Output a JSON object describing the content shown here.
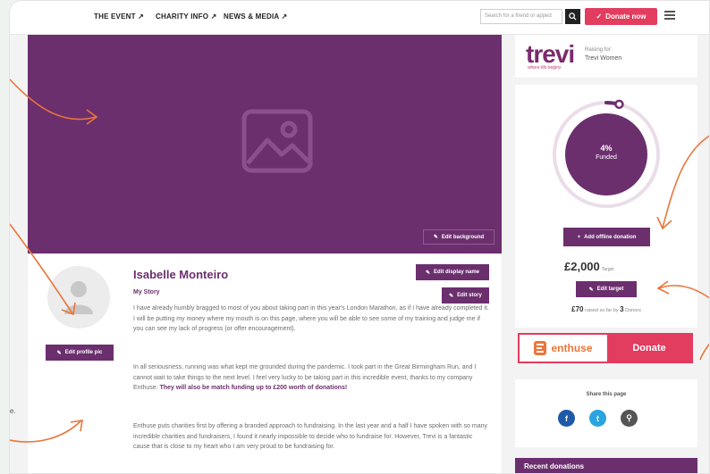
{
  "nav": {
    "links": [
      "THE EVENT ↗",
      "CHARITY INFO ↗",
      "NEWS & MEDIA ↗"
    ],
    "search_placeholder": "Search for a friend or apped",
    "donate_label": "Donate now"
  },
  "hero": {
    "edit_background_label": "Edit background"
  },
  "profile": {
    "edit_profile_label": "Edit profile pic",
    "name": "Isabelle Monteiro",
    "story_heading": "My Story",
    "edit_display_name_label": "Edit display name",
    "edit_story_label": "Edit story",
    "paragraph_1": "I have already humbly bragged to most of you about taking part in this year's London Marathon, as if I have already completed it. I will be putting my money where my mouth is on this page, where you will be able to see some of my training and judge me if you can see my lack of progress (or offer encouragement).",
    "paragraph_2": "In all seriousness, running was what kept me grounded during the pandemic. I took part in the Great Birmingham Run, and I cannot wait to take things to the next level. I feel very lucky to be taking part in this incredible event, thanks to my company Enthuse.",
    "paragraph_2_bold": "They will also be match funding up to £200 worth of donations!",
    "paragraph_3": "Enthuse puts charities first by offering a branded approach to fundraising. In the last year and a half I have spoken with so many incredible charities and fundraisers, I found it nearly impossible to decide who to fundraise for. However, Trevi is a fantastic cause that is close to my heart who I am very proud to be fundraising for."
  },
  "charity": {
    "logo": "trevi",
    "logo_tagline": "where life begins",
    "raising_for_label": "Raising for:",
    "name": "Trevi Women"
  },
  "progress": {
    "percent_label": "4%",
    "funded_label": "Funded",
    "fraction": 0.04,
    "add_offline_label": "Add offline donation",
    "target_amount": "£2,000",
    "target_label": "Target",
    "edit_target_label": "Edit target",
    "raised_amount": "£70",
    "raised_text": "raised so far by",
    "donor_count": "3",
    "donors_label": "Donors"
  },
  "donate_widget": {
    "brand": "enthuse",
    "donate_label": "Donate"
  },
  "share": {
    "title": "Share this page",
    "icons": [
      "facebook-icon",
      "twitter-icon",
      "link-icon"
    ]
  },
  "recent_donations": {
    "title": "Recent donations"
  },
  "colors": {
    "purple": "#6b2f6e",
    "pink": "#e23c5f",
    "orange": "#e9763a"
  },
  "margin_note": "e."
}
